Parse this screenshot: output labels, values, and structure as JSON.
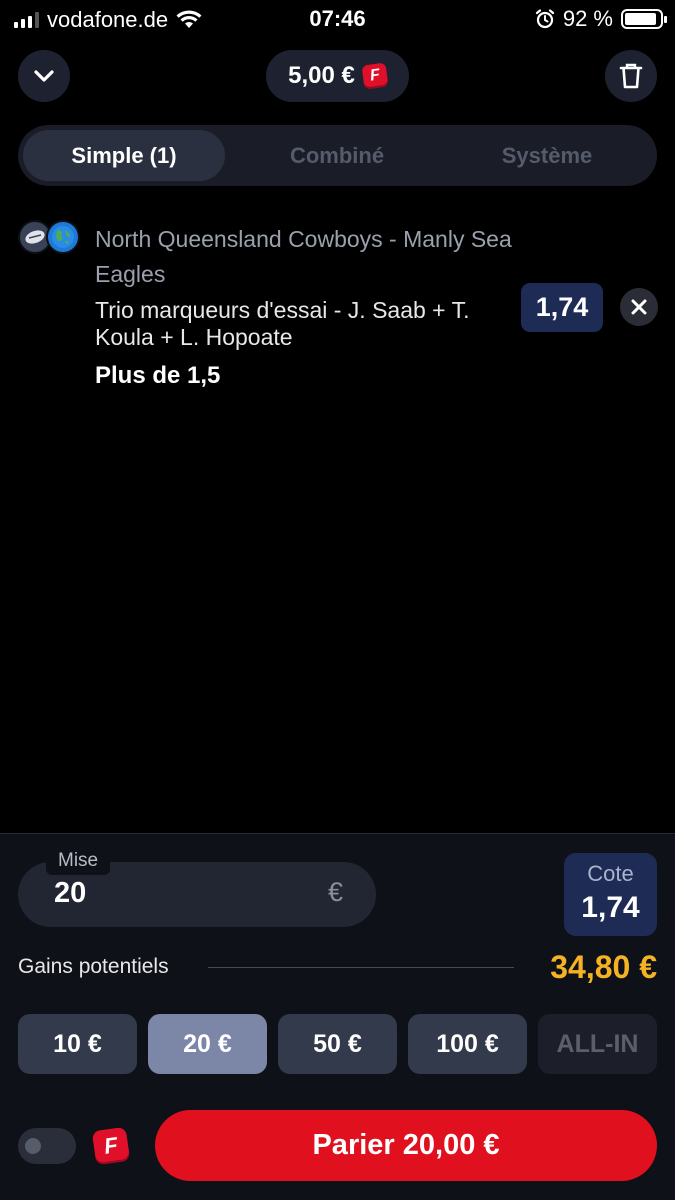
{
  "status_bar": {
    "carrier": "vodafone.de",
    "time": "07:46",
    "battery_percent": "92 %",
    "battery_level": 0.92
  },
  "header": {
    "balance": "5,00 €",
    "freebet_logo_letter": "F",
    "icons": {
      "collapse": "chevron-down-icon",
      "delete": "trash-icon"
    }
  },
  "tabs": [
    {
      "label": "Simple (1)",
      "active": true
    },
    {
      "label": "Combiné",
      "active": false
    },
    {
      "label": "Système",
      "active": false
    }
  ],
  "bet": {
    "event": "North Queensland Cowboys - Manly Sea Eagles",
    "market": "Trio marqueurs d'essai - J. Saab + T. Koula + L. Hopoate",
    "selection": "Plus de 1,5",
    "odds": "1,74",
    "icons": {
      "sport": "rugby-icon",
      "competition": "globe-icon",
      "remove": "close-icon"
    }
  },
  "stake": {
    "label": "Mise",
    "value": "20",
    "currency": "€"
  },
  "cote": {
    "label": "Cote",
    "value": "1,74"
  },
  "gains": {
    "label": "Gains potentiels",
    "value": "34,80 €"
  },
  "quick_amounts": [
    {
      "label": "10 €",
      "state": "normal"
    },
    {
      "label": "20 €",
      "state": "active"
    },
    {
      "label": "50 €",
      "state": "normal"
    },
    {
      "label": "100 €",
      "state": "normal"
    },
    {
      "label": "ALL-IN",
      "state": "disabled"
    }
  ],
  "footer": {
    "freebet_toggle_on": false,
    "freebet_logo_letter": "F",
    "bet_button_label": "Parier 20,00 €"
  },
  "colors": {
    "accent_red": "#e0101e",
    "odds_blue": "#1e2b55",
    "gains_yellow": "#f5b324"
  }
}
